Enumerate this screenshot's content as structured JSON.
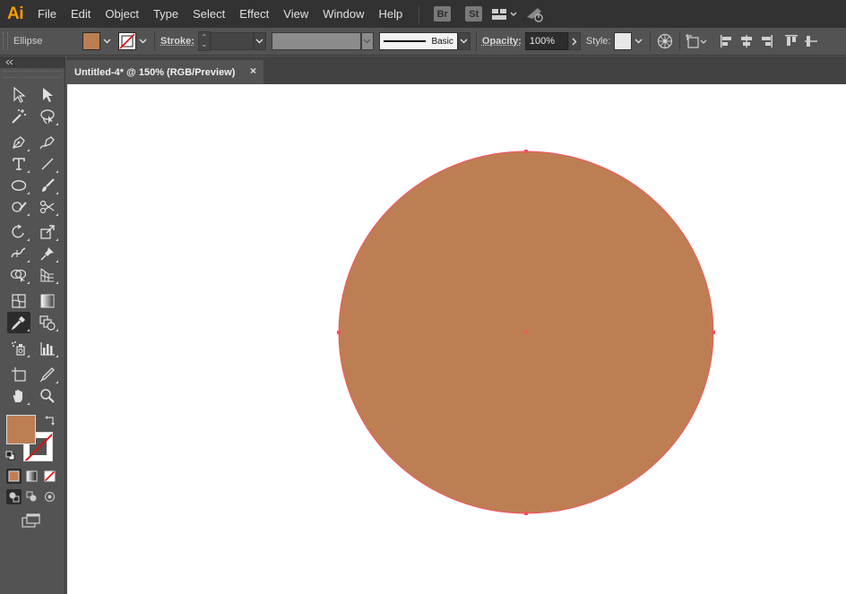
{
  "app": {
    "logo": "Ai",
    "menu": [
      "File",
      "Edit",
      "Object",
      "Type",
      "Select",
      "Effect",
      "View",
      "Window",
      "Help"
    ],
    "bridge_label": "Br",
    "stock_label": "St"
  },
  "control_bar": {
    "object_type": "Ellipse",
    "stroke_label": "Stroke:",
    "brush_name": "Basic",
    "opacity_label": "Opacity:",
    "opacity_value": "100%",
    "style_label": "Style:"
  },
  "document": {
    "tab_title": "Untitled-4* @ 150% (RGB/Preview)",
    "close_glyph": "×"
  },
  "colors": {
    "fill": "#bd7e53",
    "selection": "#ff4d5c",
    "artboard": "#ffffff"
  },
  "tools": [
    [
      "selection-tool",
      "direct-selection-tool"
    ],
    [
      "magic-wand-tool",
      "lasso-tool"
    ],
    [
      "pen-tool",
      "curvature-tool"
    ],
    [
      "type-tool",
      "line-segment-tool"
    ],
    [
      "ellipse-tool",
      "paintbrush-tool"
    ],
    [
      "shaper-tool",
      "scissors-tool"
    ],
    [
      "rotate-tool",
      "scale-tool"
    ],
    [
      "width-tool",
      "puppet-warp-tool"
    ],
    [
      "shape-builder-tool",
      "perspective-grid-tool"
    ],
    [
      "mesh-tool",
      "gradient-tool"
    ],
    [
      "eyedropper-tool",
      "blend-tool"
    ],
    [
      "symbol-sprayer-tool",
      "column-graph-tool"
    ],
    [
      "artboard-tool",
      "slice-tool"
    ],
    [
      "hand-tool",
      "zoom-tool"
    ]
  ],
  "active_tool": "eyedropper-tool"
}
